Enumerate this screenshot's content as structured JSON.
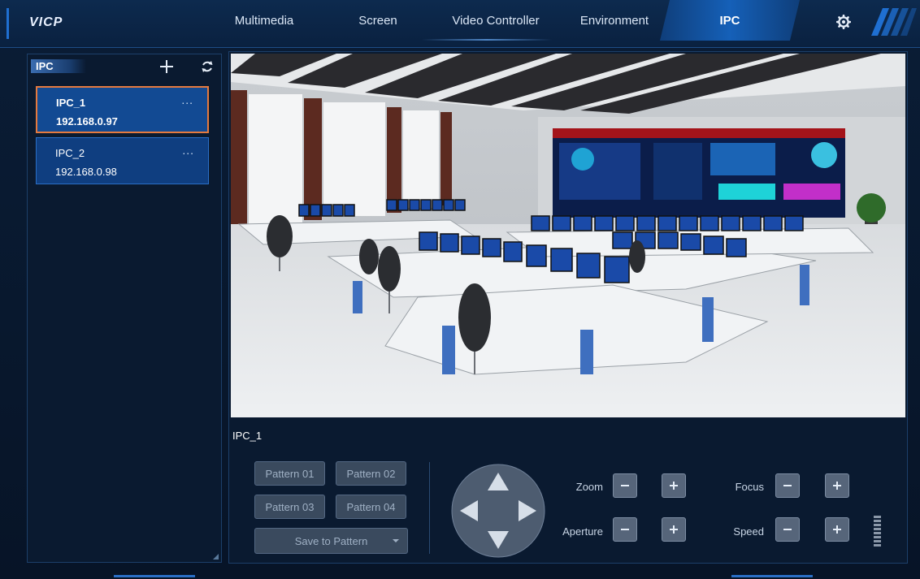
{
  "app": {
    "brand": "VICP"
  },
  "nav": {
    "items": [
      {
        "label": "Multimedia"
      },
      {
        "label": "Screen"
      },
      {
        "label": "Video Controller"
      },
      {
        "label": "Environment"
      },
      {
        "label": "IPC",
        "active": true
      }
    ],
    "settings_icon": "gear-icon"
  },
  "sidebar": {
    "title": "IPC",
    "add_icon": "plus-icon",
    "refresh_icon": "refresh-icon",
    "items": [
      {
        "name": "IPC_1",
        "ip": "192.168.0.97",
        "more": "...",
        "selected": true
      },
      {
        "name": "IPC_2",
        "ip": "192.168.0.98",
        "more": "...",
        "selected": false
      }
    ]
  },
  "preview": {
    "camera_label": "IPC_1",
    "scene": "control-room-camera-feed"
  },
  "patterns": {
    "buttons": [
      "Pattern 01",
      "Pattern 02",
      "Pattern 03",
      "Pattern 04"
    ],
    "save_label": "Save to Pattern"
  },
  "controls": {
    "zoom_label": "Zoom",
    "aperture_label": "Aperture",
    "focus_label": "Focus",
    "speed_label": "Speed"
  },
  "colors": {
    "accent": "#1560b8",
    "selected_border": "#e57a3f",
    "background": "#061326"
  }
}
